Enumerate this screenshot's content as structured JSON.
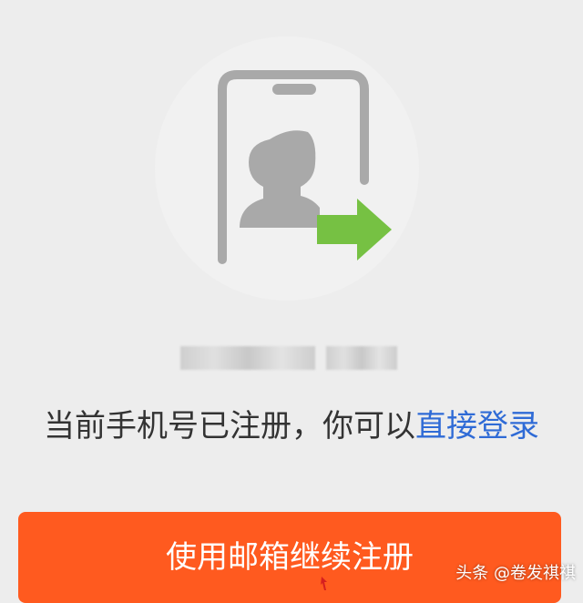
{
  "message": {
    "prefix": "当前手机号已注册，你可以",
    "link": "直接登录"
  },
  "actions": {
    "primary_label": "使用邮箱继续注册"
  },
  "watermark": {
    "text": "头条 @卷发祺祺"
  },
  "icons": {
    "illustration": "phone-user-arrow-icon",
    "cursor": "pointer-cursor-icon"
  },
  "colors": {
    "accent": "#ff5a1f",
    "link": "#2f6bd6",
    "arrow": "#76c143",
    "illustration_gray": "#a9a9a9"
  }
}
